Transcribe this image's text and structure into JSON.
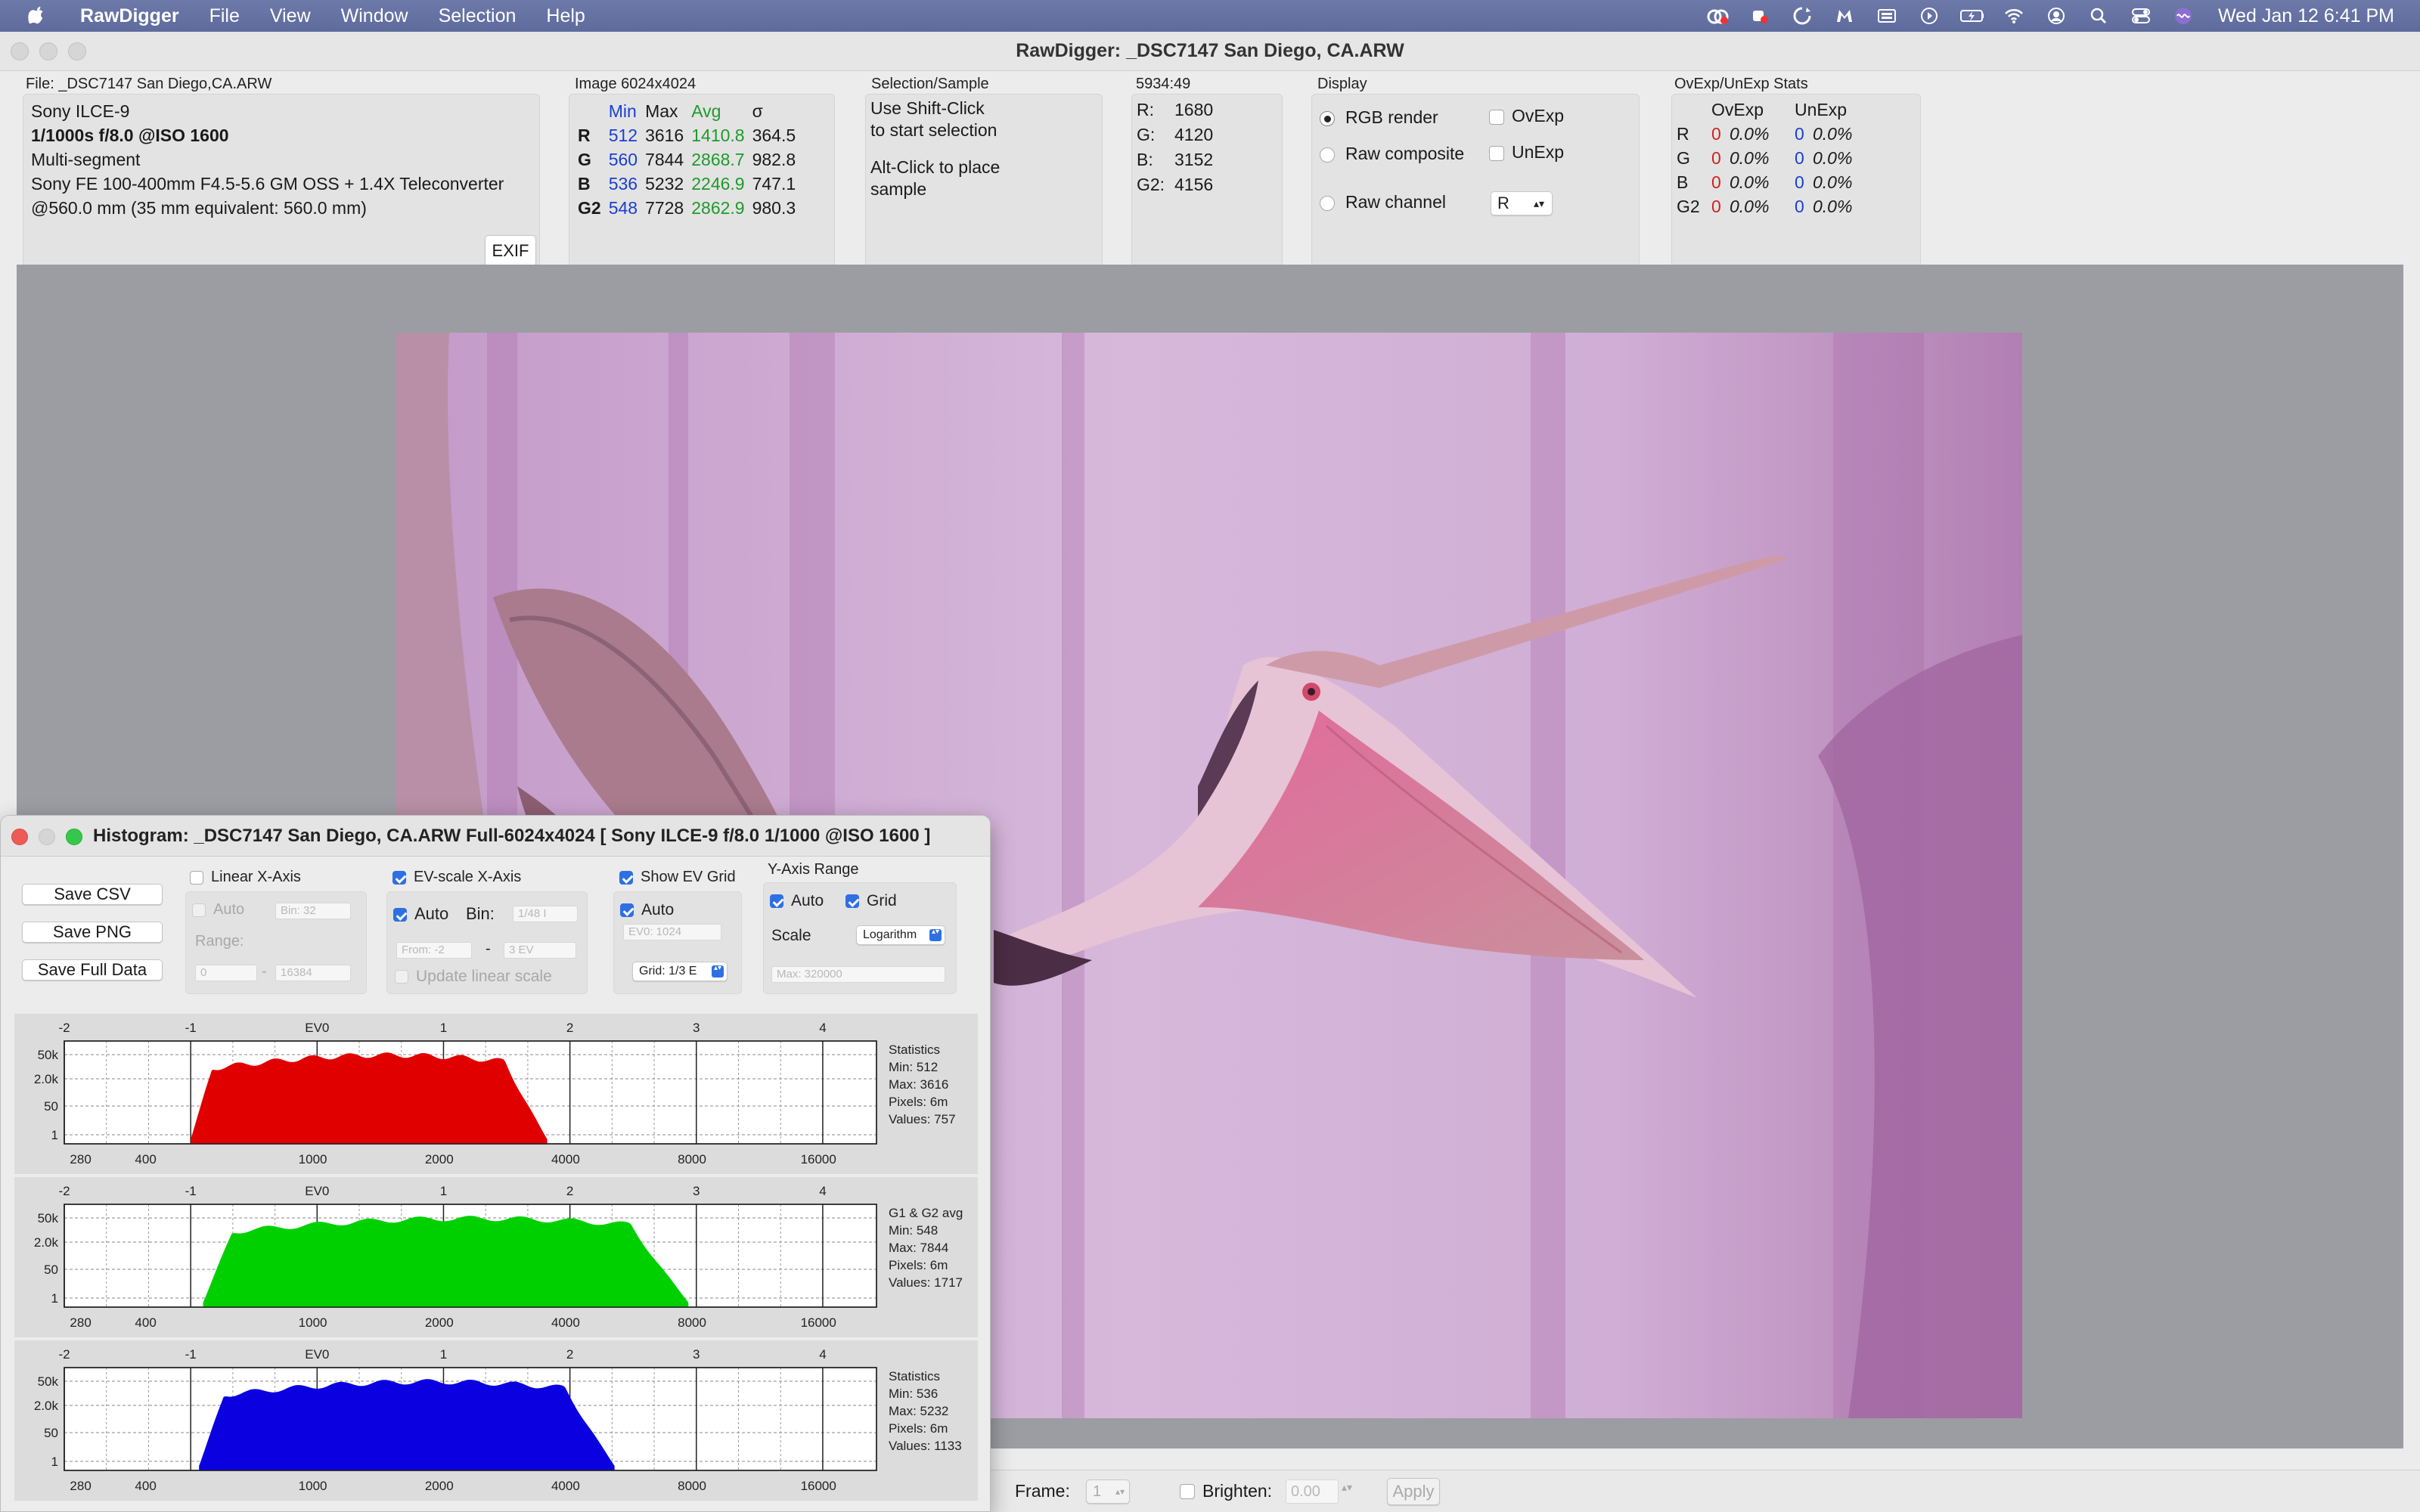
{
  "menubar": {
    "app_name": "RawDigger",
    "items": [
      "File",
      "View",
      "Window",
      "Selection",
      "Help"
    ],
    "clock": "Wed Jan 12  6:41 PM",
    "status_icons": [
      "creative-cloud-icon",
      "recorder-icon",
      "sync-icon",
      "malwarebytes-icon",
      "keyboard-icon",
      "play-icon",
      "battery-icon",
      "wifi-icon",
      "user-icon",
      "spotlight-icon",
      "control-center-icon",
      "siri-icon"
    ]
  },
  "window": {
    "title": "RawDigger: _DSC7147  San Diego, CA.ARW"
  },
  "file_info": {
    "header": "File: _DSC7147  San Diego,CA.ARW",
    "camera": "Sony ILCE-9",
    "exposure": "1/1000s f/8.0 @ISO 1600",
    "mode": "Multi-segment",
    "lens": "Sony FE 100-400mm F4.5-5.6 GM OSS + 1.4X Teleconverter",
    "focal": "@560.0 mm (35 mm equivalent: 560.0 mm)",
    "exif_button": "EXIF"
  },
  "image_stats": {
    "header": "Image 6024x4024",
    "columns": [
      "Min",
      "Max",
      "Avg",
      "σ"
    ],
    "rows": [
      {
        "ch": "R",
        "min": "512",
        "max": "3616",
        "avg": "1410.8",
        "sigma": "364.5"
      },
      {
        "ch": "G",
        "min": "560",
        "max": "7844",
        "avg": "2868.7",
        "sigma": "982.8"
      },
      {
        "ch": "B",
        "min": "536",
        "max": "5232",
        "avg": "2246.9",
        "sigma": "747.1"
      },
      {
        "ch": "G2",
        "min": "548",
        "max": "7728",
        "avg": "2862.9",
        "sigma": "980.3"
      }
    ]
  },
  "selection": {
    "header": "Selection/Sample",
    "line1": "Use Shift-Click",
    "line2": "to start selection",
    "line3": "Alt-Click to place",
    "line4": "sample"
  },
  "sample": {
    "header": "5934:49",
    "rows": [
      {
        "label": "R:",
        "value": "1680"
      },
      {
        "label": "G:",
        "value": "4120"
      },
      {
        "label": "B:",
        "value": "3152"
      },
      {
        "label": "G2:",
        "value": "4156"
      }
    ]
  },
  "display": {
    "header": "Display",
    "rgb_render": "RGB render",
    "raw_composite": "Raw composite",
    "raw_channel": "Raw channel",
    "ovexp": "OvExp",
    "unexp": "UnExp",
    "channel_select": "R"
  },
  "ovexp_stats": {
    "header": "OvExp/UnExp Stats",
    "col1": "OvExp",
    "col2": "UnExp",
    "rows": [
      {
        "ch": "R",
        "ov_n": "0",
        "ov_p": "0.0%",
        "un_n": "0",
        "un_p": "0.0%"
      },
      {
        "ch": "G",
        "ov_n": "0",
        "ov_p": "0.0%",
        "un_n": "0",
        "un_p": "0.0%"
      },
      {
        "ch": "B",
        "ov_n": "0",
        "ov_p": "0.0%",
        "un_n": "0",
        "un_p": "0.0%"
      },
      {
        "ch": "G2",
        "ov_n": "0",
        "ov_p": "0.0%",
        "un_n": "0",
        "un_p": "0.0%"
      }
    ]
  },
  "bottombar": {
    "frame_label": "Frame:",
    "frame_value": "1",
    "brighten_label": "Brighten:",
    "brighten_value": "0.00",
    "apply": "Apply"
  },
  "histogram": {
    "title": "Histogram: _DSC7147  San Diego, CA.ARW Full-6024x4024 [ Sony ILCE-9 f/8.0 1/1000 @ISO 1600 ]",
    "buttons": {
      "save_csv": "Save CSV",
      "save_png": "Save PNG",
      "save_full": "Save Full Data"
    },
    "linear": {
      "label": "Linear X-Axis",
      "auto": "Auto",
      "bin": "Bin: 32",
      "range": "Range:",
      "from": "0",
      "dash": "-",
      "to": "16384"
    },
    "ev": {
      "label": "EV-scale X-Axis",
      "auto": "Auto",
      "bin_label": "Bin:",
      "bin": "1/48 I",
      "from": "From: -2",
      "dash": "-",
      "to": "3 EV",
      "update": "Update linear scale"
    },
    "evgrid": {
      "label": "Show EV Grid",
      "auto": "Auto",
      "ev0": "EV0: 1024",
      "grid": "Grid: 1/3 E"
    },
    "yaxis": {
      "label": "Y-Axis Range",
      "auto": "Auto",
      "grid": "Grid",
      "scale_label": "Scale",
      "scale": "Logarithm",
      "max": "Max: 320000"
    },
    "ev_ticks": [
      "-2",
      "-1",
      "EV0",
      "1",
      "2",
      "3",
      "4"
    ],
    "lin_ticks": [
      "280",
      "400",
      "1000",
      "2000",
      "4000",
      "8000",
      "16000"
    ],
    "y_ticks": [
      "50k",
      "2.0k",
      "50",
      "1"
    ]
  },
  "chart_data": [
    {
      "type": "area",
      "name": "R",
      "color": "#e00000",
      "title": "Statistics",
      "stats": [
        "Min: 512",
        "Max: 3616",
        "Pixels: 6m",
        "Values: 757"
      ],
      "x_min": 512,
      "x_max": 3616,
      "x_scale": "log",
      "xlim": [
        256,
        22000
      ]
    },
    {
      "type": "area",
      "name": "G",
      "color": "#00d000",
      "title": "G1 & G2 avg",
      "stats": [
        "Min: 548",
        "Max: 7844",
        "Pixels: 6m",
        "Values: 1717"
      ],
      "x_min": 548,
      "x_max": 7844,
      "x_scale": "log",
      "xlim": [
        256,
        22000
      ]
    },
    {
      "type": "area",
      "name": "B",
      "color": "#0a00e0",
      "title": "Statistics",
      "stats": [
        "Min: 536",
        "Max: 5232",
        "Pixels: 6m",
        "Values: 1133"
      ],
      "x_min": 536,
      "x_max": 5232,
      "x_scale": "log",
      "xlim": [
        256,
        22000
      ]
    }
  ],
  "colors": {
    "accent": "#2f6fe4",
    "red": "#d0211e",
    "blue": "#1a3fd0",
    "green": "#1f9a2a",
    "photo_tint": "#c79bc6"
  }
}
